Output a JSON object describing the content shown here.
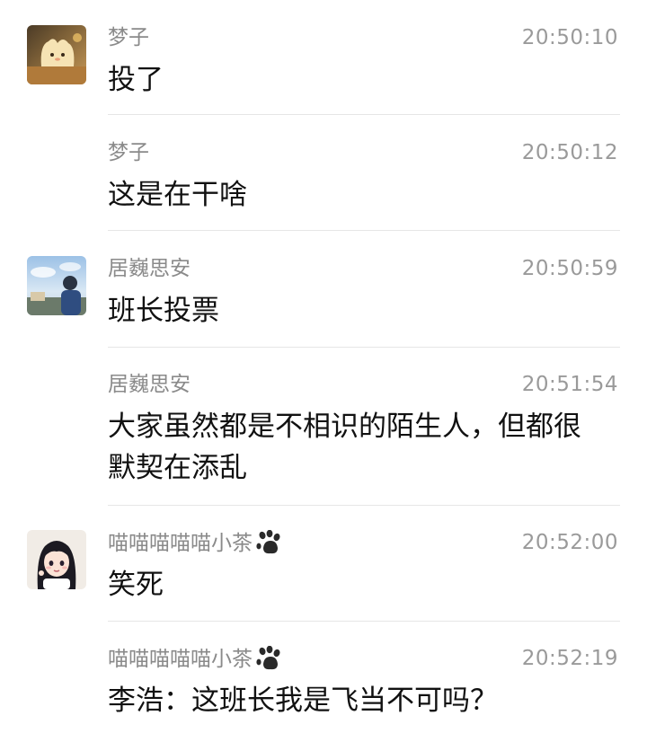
{
  "messages": [
    {
      "sender": "梦子",
      "time": "20:50:10",
      "text": "投了",
      "avatar": "cat-bread-avatar",
      "has_avatar": true,
      "paw": false
    },
    {
      "sender": "梦子",
      "time": "20:50:12",
      "text": "这是在干啥",
      "avatar": "",
      "has_avatar": false,
      "paw": false
    },
    {
      "sender": "居巍思安",
      "time": "20:50:59",
      "text": "班长投票",
      "avatar": "sky-person-avatar",
      "has_avatar": true,
      "paw": false
    },
    {
      "sender": "居巍思安",
      "time": "20:51:54",
      "text": "大家虽然都是不相识的陌生人，但都很\n默契在添乱",
      "avatar": "",
      "has_avatar": false,
      "paw": false
    },
    {
      "sender": "喵喵喵喵喵小茶",
      "time": "20:52:00",
      "text": "笑死",
      "avatar": "anime-girl-avatar",
      "has_avatar": true,
      "paw": true
    },
    {
      "sender": "喵喵喵喵喵小茶",
      "time": "20:52:19",
      "text": "李浩：这班长我是飞当不可吗？",
      "avatar": "",
      "has_avatar": false,
      "paw": true
    }
  ]
}
